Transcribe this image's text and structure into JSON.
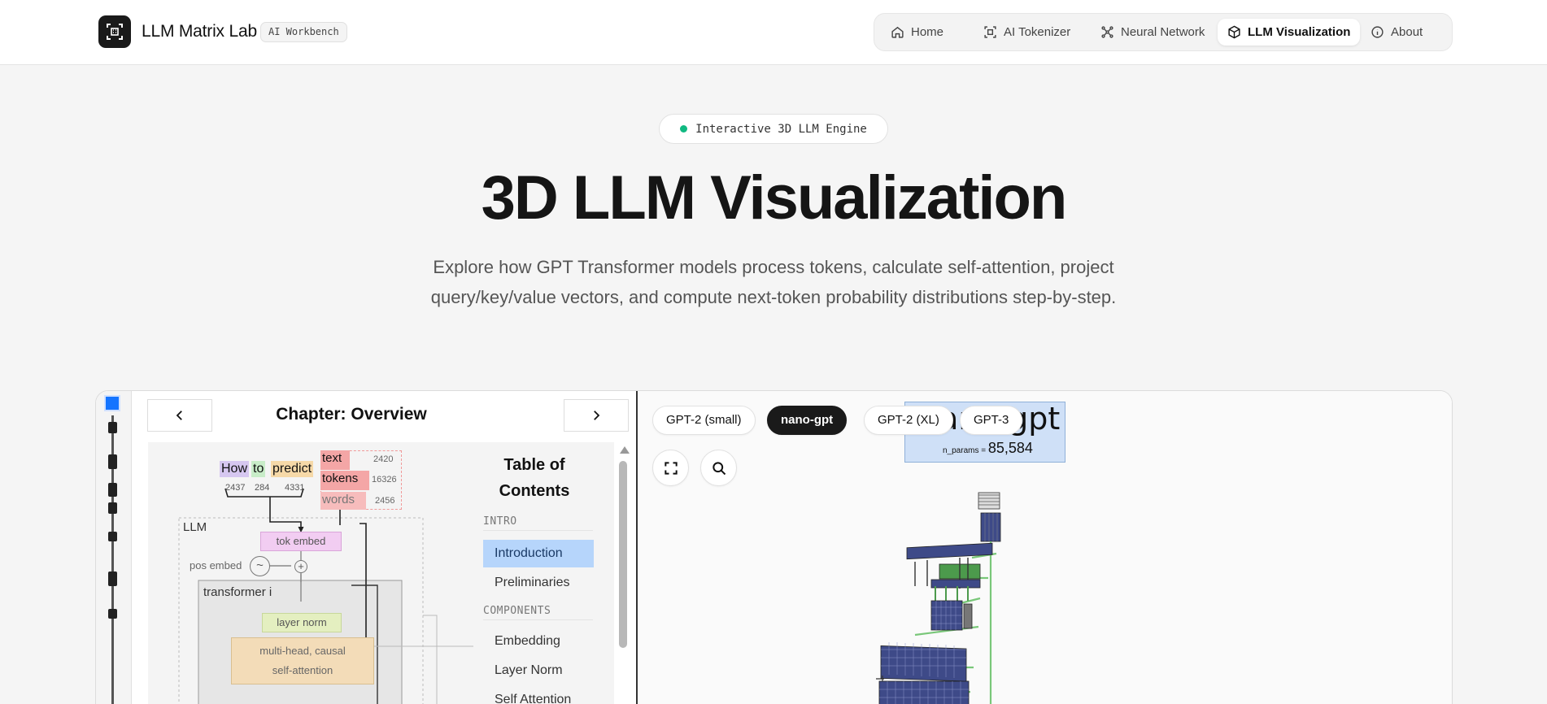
{
  "header": {
    "brand": "LLM Matrix Lab",
    "badge": "AI Workbench",
    "nav": [
      {
        "label": "Home",
        "icon": "home-icon",
        "active": false
      },
      {
        "label": "AI Tokenizer",
        "icon": "scan-icon",
        "active": false
      },
      {
        "label": "Neural Network",
        "icon": "network-icon",
        "active": false
      },
      {
        "label": "LLM Visualization",
        "icon": "cube-icon",
        "active": true
      },
      {
        "label": "About",
        "icon": "info-icon",
        "active": false
      }
    ]
  },
  "hero": {
    "pill": "Interactive 3D LLM Engine",
    "title": "3D LLM Visualization",
    "subtitle": "Explore how GPT Transformer models process tokens, calculate self-attention, project query/key/value vectors, and compute next-token probability distributions step-by-step."
  },
  "chapter": {
    "title": "Chapter: Overview"
  },
  "diagram": {
    "tokens": [
      {
        "text": "How",
        "id": "2437",
        "color": "#d6c7f0"
      },
      {
        "text": "to",
        "id": "284",
        "color": "#c8ecc8"
      },
      {
        "text": "predict",
        "id": "4331",
        "color": "#f6d9a8"
      }
    ],
    "outputs": [
      {
        "text": "text",
        "id": "2420"
      },
      {
        "text": "tokens",
        "id": "16326"
      },
      {
        "text": "words",
        "id": "2456"
      }
    ],
    "llm_label": "LLM",
    "tok_embed": "tok embed",
    "pos_embed": "pos embed",
    "pos_symbol": "~",
    "plus_symbol": "+",
    "transformer": "transformer i",
    "layer_norm": "layer norm",
    "mhsa_line1": "multi-head, causal",
    "mhsa_line2": "self-attention"
  },
  "toc": {
    "title_line1": "Table of",
    "title_line2": "Contents",
    "sections": [
      {
        "label": "INTRO",
        "items": [
          "Introduction",
          "Preliminaries"
        ]
      },
      {
        "label": "COMPONENTS",
        "items": [
          "Embedding",
          "Layer Norm",
          "Self Attention"
        ]
      }
    ],
    "active": "Introduction"
  },
  "viewer": {
    "models": [
      {
        "label": "GPT-2 (small)",
        "active": false
      },
      {
        "label": "nano-gpt",
        "active": true
      },
      {
        "label": "GPT-2 (XL)",
        "active": false
      },
      {
        "label": "GPT-3",
        "active": false
      }
    ],
    "tools": [
      "expand-icon",
      "search-icon"
    ],
    "model_name": "nano-gpt",
    "params_key": "n_params = ",
    "params_value": "85,584"
  },
  "colors": {
    "accent": "#1474ff",
    "status": "#10b981",
    "toc_active": "#b6d5fb",
    "output_token": "#f4a6a6",
    "tok_embed": "#f2cdf2",
    "layer_norm": "#e4efc0",
    "mhsa": "#f3dcb8",
    "model_cells": "#3e4a88",
    "model_lines": "#79c779"
  }
}
